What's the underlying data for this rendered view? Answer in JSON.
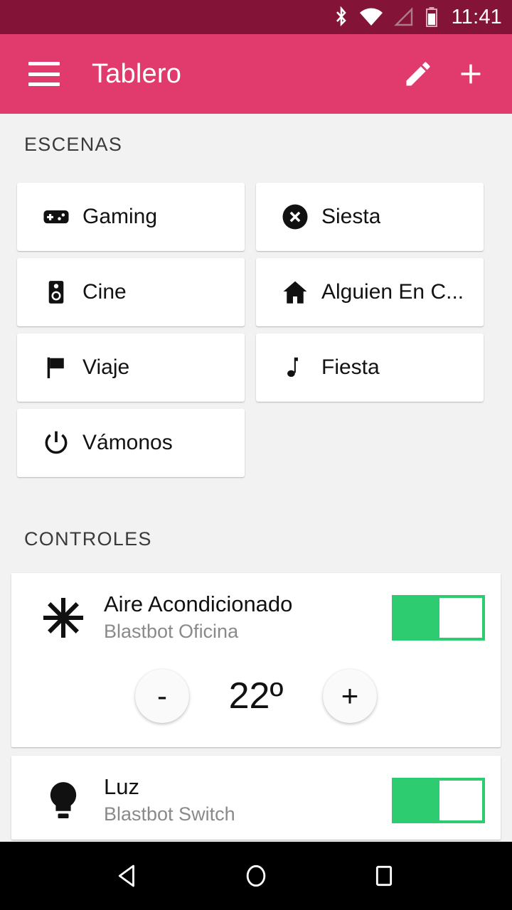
{
  "status_bar": {
    "time": "11:41",
    "icons": [
      "bluetooth-icon",
      "wifi-icon",
      "cellular-signal-icon",
      "battery-icon"
    ],
    "background_color": "#841437"
  },
  "app_bar": {
    "title": "Tablero",
    "menu_icon": "hamburger-menu-icon",
    "edit_icon": "pencil-edit-icon",
    "add_icon": "plus-add-icon",
    "background_color": "#e13a6c"
  },
  "scenes": {
    "header": "ESCENAS",
    "items": [
      {
        "label": "Gaming",
        "icon": "gamepad-icon"
      },
      {
        "label": "Siesta",
        "icon": "x-circle-icon"
      },
      {
        "label": "Cine",
        "icon": "speaker-icon"
      },
      {
        "label": "Alguien En C...",
        "icon": "home-icon"
      },
      {
        "label": "Viaje",
        "icon": "flag-icon"
      },
      {
        "label": "Fiesta",
        "icon": "music-note-icon"
      },
      {
        "label": "Vámonos",
        "icon": "power-icon"
      }
    ]
  },
  "controls": {
    "header": "CONTROLES",
    "toggle_on_color": "#2ecc71",
    "items": [
      {
        "name": "Aire Acondicionado",
        "subtitle": "Blastbot Oficina",
        "icon": "snowflake-icon",
        "toggle_state": "on",
        "temperature": "22º",
        "decrease_label": "-",
        "increase_label": "+"
      },
      {
        "name": "Luz",
        "subtitle": "Blastbot Switch",
        "icon": "lightbulb-icon",
        "toggle_state": "on"
      }
    ]
  },
  "nav_bar": {
    "back": "back-triangle-icon",
    "home": "home-circle-icon",
    "recents": "recents-square-icon"
  }
}
